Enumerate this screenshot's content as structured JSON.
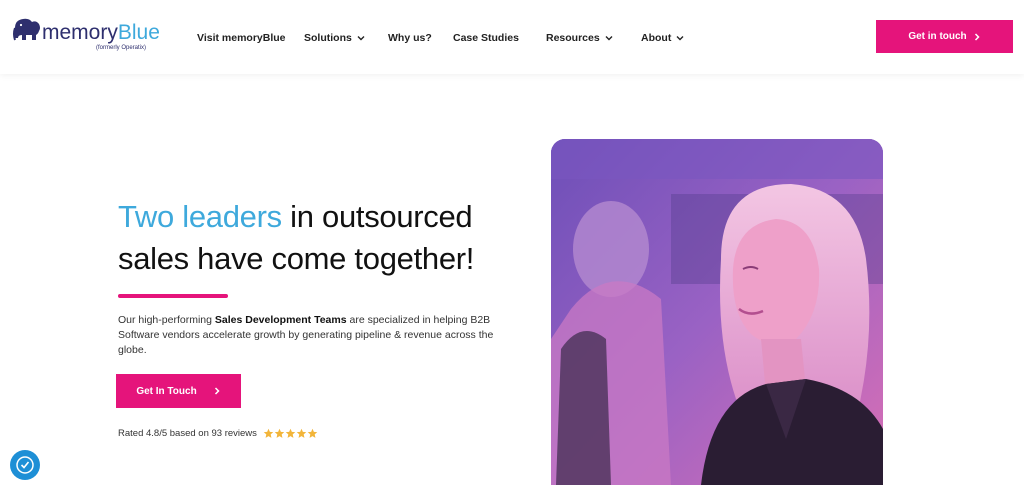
{
  "brand": {
    "name_part1": "memory",
    "name_part2": "Blue",
    "tagline": "(formerly Operatix)",
    "accent": "#e5147b",
    "blue": "#3ea9dc",
    "navy": "#2e2f6e"
  },
  "nav": {
    "items": [
      {
        "label": "Visit memoryBlue",
        "has_dropdown": false
      },
      {
        "label": "Solutions",
        "has_dropdown": true
      },
      {
        "label": "Why us?",
        "has_dropdown": false
      },
      {
        "label": "Case Studies",
        "has_dropdown": false
      },
      {
        "label": "Resources",
        "has_dropdown": true
      },
      {
        "label": "About",
        "has_dropdown": true
      }
    ],
    "cta_label": "Get in touch"
  },
  "hero": {
    "headline_highlight": "Two leaders",
    "headline_line1_rest": " in outsourced",
    "headline_line2": "sales have come together!",
    "desc_prefix": "Our high-performing ",
    "desc_bold": "Sales Development Teams",
    "desc_suffix": " are specialized in helping B2B Software vendors accelerate growth by generating pipeline & revenue across the globe.",
    "cta_label": "Get In Touch",
    "rating_text": "Rated 4.8/5 based on 93 reviews",
    "star_count": 5,
    "star_color": "#f2b53a"
  },
  "icons": {
    "logo": "elephant-logo-icon",
    "chevron": "chevron-down-icon",
    "arrow": "chevron-right-icon",
    "star": "star-icon",
    "accessibility": "accessibility-icon"
  }
}
